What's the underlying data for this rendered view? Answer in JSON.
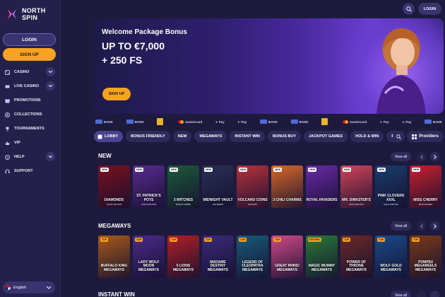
{
  "brand": {
    "line1": "NORTH",
    "line2": "SPIN"
  },
  "sidebar": {
    "login": "LOGIN",
    "signup": "SIGN UP",
    "items": [
      {
        "label": "CASINO",
        "icon": "casino-icon",
        "expand": true
      },
      {
        "label": "LIVE CASINO",
        "icon": "live-casino-icon",
        "expand": true
      },
      {
        "label": "PROMOTIONS",
        "icon": "promotions-icon",
        "expand": false
      },
      {
        "label": "COLLECTIONS",
        "icon": "collections-icon",
        "expand": false
      },
      {
        "label": "TOURNAMENTS",
        "icon": "trophy-icon",
        "expand": false
      },
      {
        "label": "VIP",
        "icon": "crown-icon",
        "expand": false
      },
      {
        "label": "HELP",
        "icon": "help-icon",
        "expand": true
      },
      {
        "label": "SUPPORT",
        "icon": "support-icon",
        "expand": false
      }
    ],
    "language": "English"
  },
  "header": {
    "login": "LOGIN"
  },
  "hero": {
    "title": "Welcome Package Bonus",
    "line1": "UP TO €7,000",
    "line2": "+ 250 FS",
    "cta": "SIGN UP"
  },
  "payments": [
    "BANK",
    "BANK",
    "",
    "mastercard",
    "Pay",
    "Pay",
    "BANK",
    "BANK",
    "",
    "mastercard",
    "Pay",
    "Pay",
    "BANK"
  ],
  "tabs": [
    "LOBBY",
    "BONUS FRIENDLY",
    "NEW",
    "MEGAWAYS",
    "INSTANT WIN",
    "BONUS BUY",
    "JACKPOT GAMES",
    "HOLD & WIN",
    "BES"
  ],
  "providers_label": "Providers",
  "sections": {
    "new": {
      "title": "NEW",
      "view_all": "View all",
      "games": [
        {
          "badge": "NEW",
          "title": "DIAMONDS",
          "sub": "HOLD AND WIN",
          "color": "#7a1020"
        },
        {
          "badge": "NEW",
          "title": "ST. PATRICK'S POTS",
          "sub": "HOLD AND WIN",
          "color": "#5a2b8f"
        },
        {
          "badge": "NEW",
          "title": "3 WITCHES",
          "sub": "BONUS COMBO",
          "color": "#1d5a3a"
        },
        {
          "badge": "NEW",
          "title": "MIDNIGHT VAULT",
          "sub": "HOLD&WIN",
          "color": "#2a2f55"
        },
        {
          "badge": "NEW",
          "title": "VOLCANO COINS",
          "sub": "PLAYSON",
          "color": "#b8323d"
        },
        {
          "badge": "NEW",
          "title": "3 CHILI CHARMS",
          "sub": "",
          "color": "#d9682a"
        },
        {
          "badge": "NEW",
          "title": "ROYAL INVADERS",
          "sub": "",
          "color": "#6a2aa8"
        },
        {
          "badge": "NEW",
          "title": "MR. DINKSTER'S",
          "sub": "HOLD AND WIN",
          "color": "#d4455a"
        },
        {
          "badge": "NEW",
          "title": "PINK CLOVERS XXXL",
          "sub": "HOLD AND WIN",
          "color": "#1a3d6e"
        },
        {
          "badge": "NEW",
          "title": "MISS CHERRY",
          "sub": "WILD FRAMES",
          "color": "#c8202e"
        }
      ]
    },
    "megaways": {
      "title": "MEGAWAYS",
      "view_all": "View all",
      "games": [
        {
          "badge": "TOP",
          "title": "BUFFALO KING MEGAWAYS",
          "sub": "",
          "color": "#a85a1a"
        },
        {
          "badge": "TOP",
          "title": "LADY WOLF MOON MEGAWAYS",
          "sub": "",
          "color": "#4a2a8a"
        },
        {
          "badge": "TOP",
          "title": "5 LIONS MEGAWAYS",
          "sub": "",
          "color": "#b02028"
        },
        {
          "badge": "TOP",
          "title": "MADAME DESTINY MEGAWAYS",
          "sub": "",
          "color": "#3a2a7a"
        },
        {
          "badge": "TOP",
          "title": "LEGEND OF CLEOPATRA MEGAWAYS",
          "sub": "",
          "color": "#1a5a7a"
        },
        {
          "badge": "TOP",
          "title": "GREAT RHINO MEGAWAYS",
          "sub": "",
          "color": "#d04a8a"
        },
        {
          "badge": "RTP 96%",
          "title": "MAGIC MUMMY MEGAWAYS",
          "sub": "",
          "color": "#2a7a3a"
        },
        {
          "badge": "TOP",
          "title": "POWER OF THRONE MEGAWAYS",
          "sub": "",
          "color": "#6a2a2a"
        },
        {
          "badge": "TOP",
          "title": "WOLF GOLD MEGAWAYS",
          "sub": "",
          "color": "#1a4a8a"
        },
        {
          "badge": "TOP",
          "title": "POMPEII MEGAREELS MEGAWAYS",
          "sub": "",
          "color": "#7a3a1a"
        }
      ]
    },
    "instant": {
      "title": "INSTANT WIN",
      "view_all": "View all"
    }
  }
}
